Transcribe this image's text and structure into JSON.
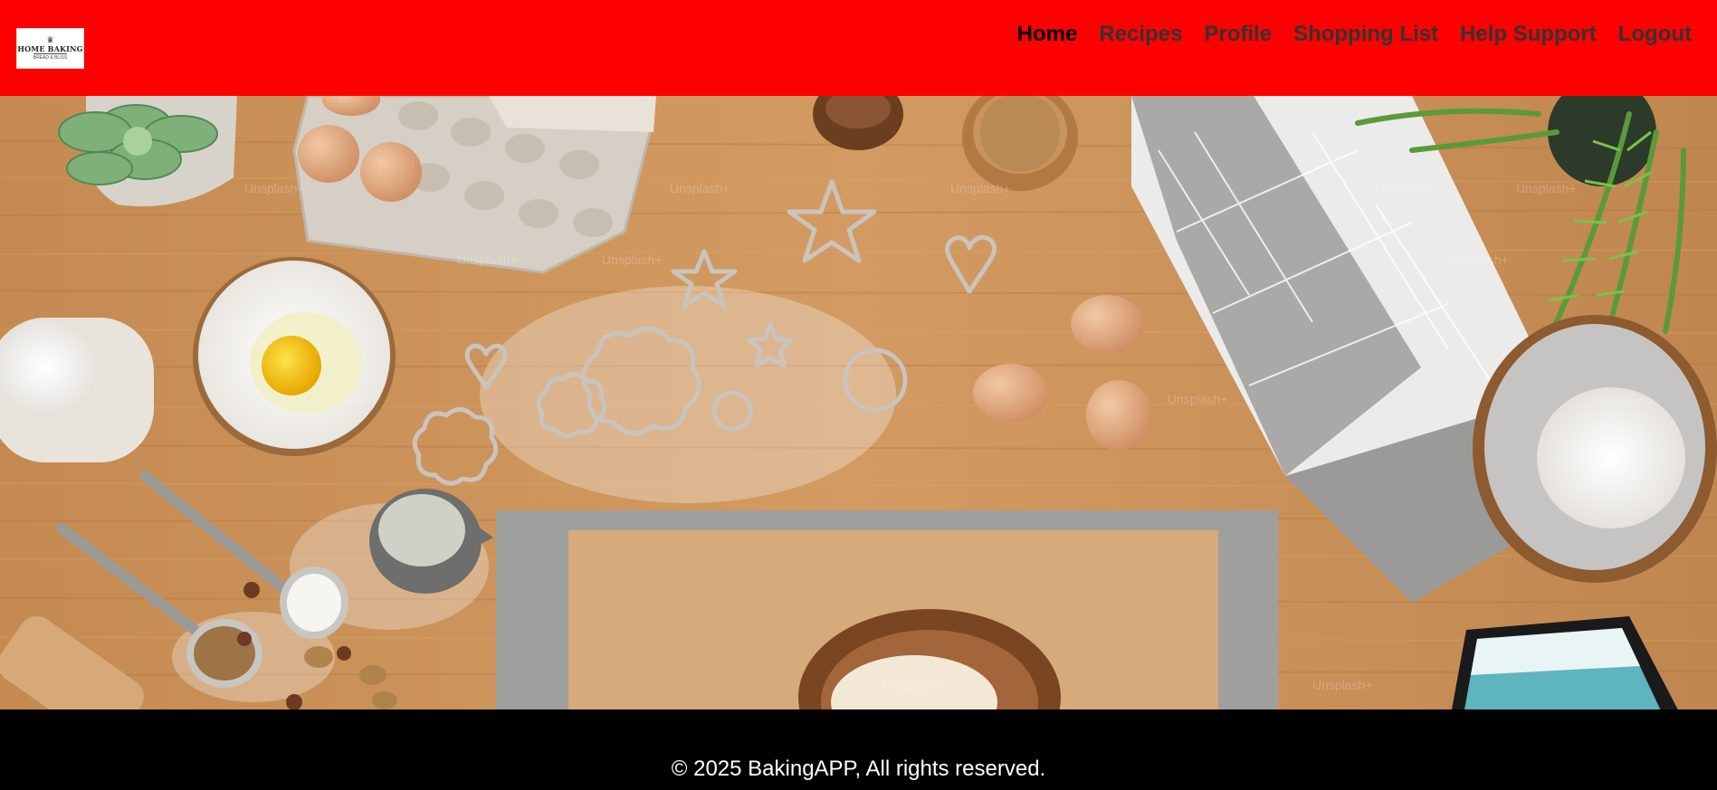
{
  "header": {
    "logo": {
      "hat_glyph": "♛",
      "name": "HOME BAKING",
      "tagline": "BREAD & BLISS"
    },
    "nav": [
      {
        "label": "Home",
        "active": true
      },
      {
        "label": "Recipes"
      },
      {
        "label": "Profile"
      },
      {
        "label": "Shopping List"
      },
      {
        "label": "Help Support"
      },
      {
        "label": "Logout"
      }
    ],
    "colors": {
      "background": "#ff0000",
      "nav_text": "#333333",
      "nav_active": "#000000"
    }
  },
  "hero": {
    "image_subject": "baking-table",
    "watermark": "Unsplash+"
  },
  "footer": {
    "copyright": "© 2025 BakingAPP, All rights reserved.",
    "background": "#000000"
  }
}
